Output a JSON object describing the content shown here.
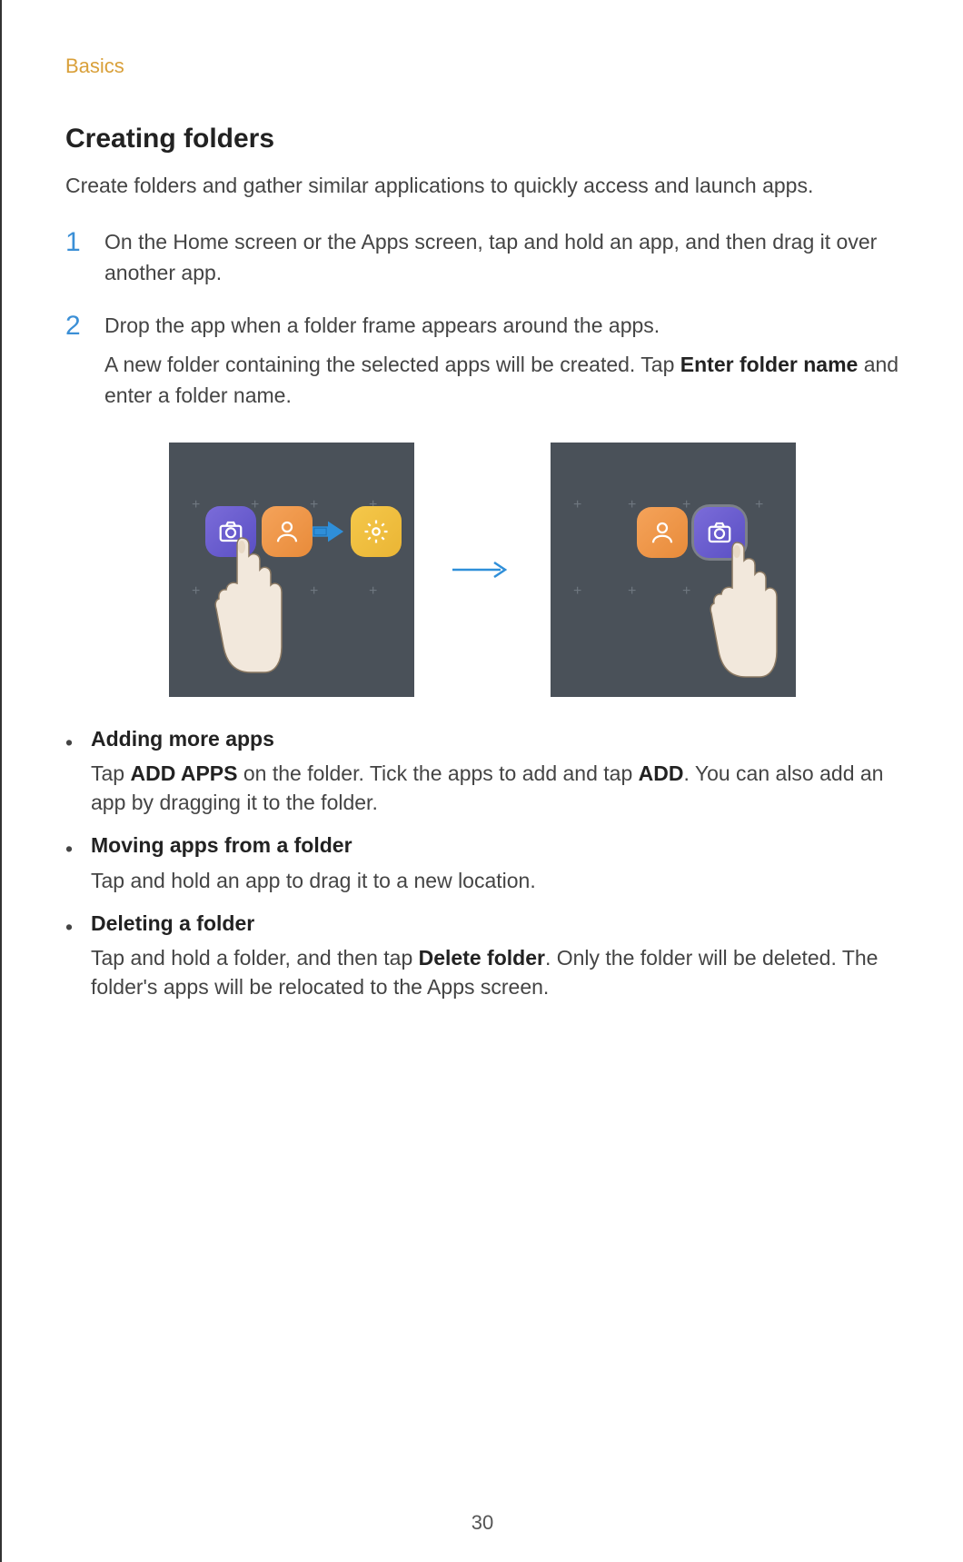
{
  "header": "Basics",
  "title": "Creating folders",
  "intro": "Create folders and gather similar applications to quickly access and launch apps.",
  "steps": {
    "s1": {
      "num": "1",
      "text": "On the Home screen or the Apps screen, tap and hold an app, and then drag it over another app."
    },
    "s2": {
      "num": "2",
      "text1": "Drop the app when a folder frame appears around the apps.",
      "text2_a": "A new folder containing the selected apps will be created. Tap ",
      "text2_bold": "Enter folder name",
      "text2_b": " and enter a folder name."
    }
  },
  "bullets": {
    "b1": {
      "heading": "Adding more apps",
      "t1": "Tap ",
      "bold1": "ADD APPS",
      "t2": " on the folder. Tick the apps to add and tap ",
      "bold2": "ADD",
      "t3": ". You can also add an app by dragging it to the folder."
    },
    "b2": {
      "heading": "Moving apps from a folder",
      "text": "Tap and hold an app to drag it to a new location."
    },
    "b3": {
      "heading": "Deleting a folder",
      "t1": "Tap and hold a folder, and then tap ",
      "bold1": "Delete folder",
      "t2": ". Only the folder will be deleted. The folder's apps will be relocated to the Apps screen."
    }
  },
  "page_number": "30"
}
